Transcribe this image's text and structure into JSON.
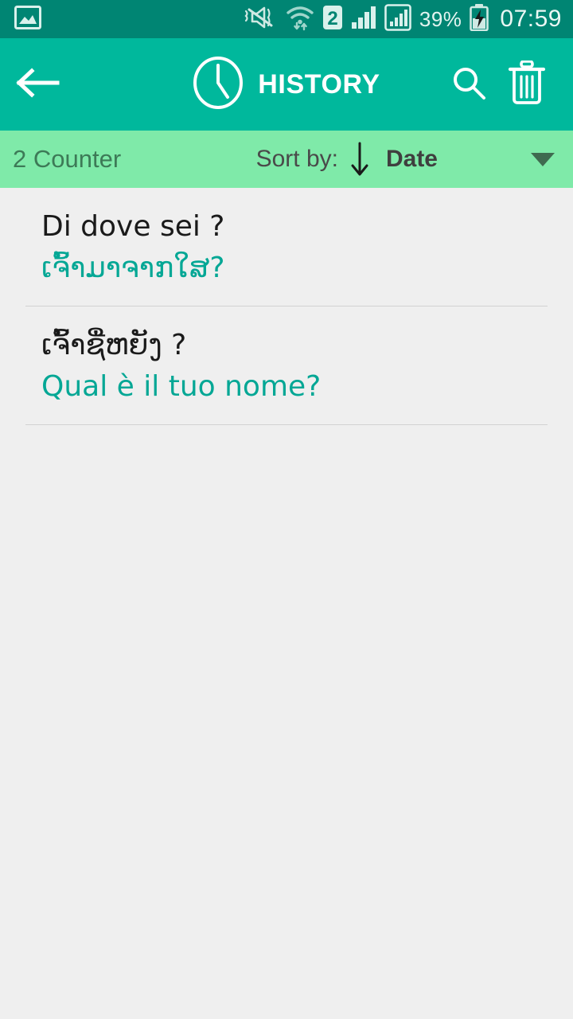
{
  "status_bar": {
    "background": "#008573",
    "icons": [
      "photo-frame-icon",
      "vibrate-mute-icon",
      "wifi-transfer-icon",
      "sim2-icon",
      "signal-bars-icon",
      "signal-boxed-icon"
    ],
    "sim_label": "2",
    "battery_percent": "39%",
    "battery_state": "charging",
    "clock": "07:59"
  },
  "app_bar": {
    "background": "#00b89c",
    "back_icon": "arrow-left-icon",
    "title_icon": "clock-icon",
    "title": "HISTORY",
    "search_icon": "search-icon",
    "delete_icon": "trash-icon"
  },
  "sort_bar": {
    "background": "#7feaa9",
    "counter": "2 Counter",
    "sort_by_label": "Sort by:",
    "sort_direction_icon": "arrow-down-icon",
    "sort_value": "Date",
    "dropdown_icon": "chevron-down-icon"
  },
  "history": {
    "items": [
      {
        "source": "Di dove sei ?",
        "target": "ເຈົ້າມາຈາກໃສ?"
      },
      {
        "source": "ເຈົ້າຊື່ຫຍັງ ?",
        "target": "Qual è il tuo nome?"
      }
    ]
  },
  "colors": {
    "status_bar": "#008573",
    "app_bar": "#00b89c",
    "sort_bar": "#7feaa9",
    "page_background": "#efefef",
    "source_text": "#1a1a1a",
    "target_text": "#04a795",
    "divider": "#d2d2d2"
  }
}
